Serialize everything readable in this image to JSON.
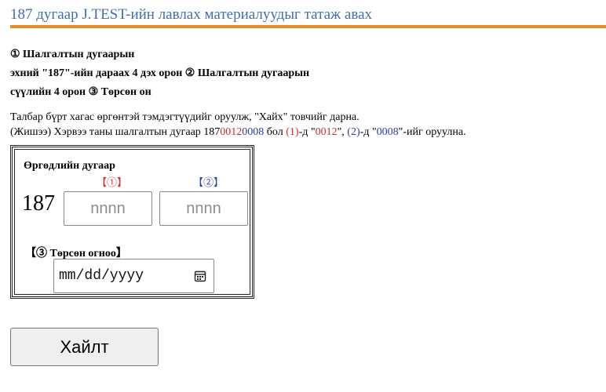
{
  "header": {
    "title": "187 дугаар J.TEST-ийн лавлах материалуудыг татаж авах"
  },
  "instructions": {
    "line1": "① Шалгалтын дугаарын",
    "line2": "эхний \"187\"-ийн дараах 4 дэх орон ② Шалгалтын дугаарын",
    "line3": "сүүлийн 4 орон ③ Төрсөн он"
  },
  "note": {
    "line1": "Талбар бүрт хагас өргөнтэй тэмдэгтүүдийг оруулж, \"Хайх\" товчийг дарна.",
    "example_prefix": "(Жишээ) Хэрвээ таны шалгалтын дугаар 187",
    "example_number_red": "0012",
    "example_number_blue": "0008",
    "example_mid1": " бол ",
    "marker1": "(1)",
    "example_mid2": "-д \"",
    "example_mid3": "\", ",
    "marker2": "(2)",
    "example_mid4": "-д \"",
    "example_suffix": "\"-ийг оруулна."
  },
  "form": {
    "heading": "Өргөдлийн дугаар",
    "marker1": "【①】",
    "marker2": "【②】",
    "prefix": "187",
    "input1_placeholder": "nnnn",
    "input2_placeholder": "nnnn",
    "date_label": "【③ Төрсөн огноо】",
    "date_placeholder": "mm/dd/yyyy",
    "date_icon": "calendar-icon"
  },
  "actions": {
    "search_label": "Хайлт"
  },
  "colors": {
    "title": "#3f6fb0",
    "rule": "#e08e2c",
    "marker_red": "#d22b2b",
    "marker_blue": "#2a3f9e"
  }
}
